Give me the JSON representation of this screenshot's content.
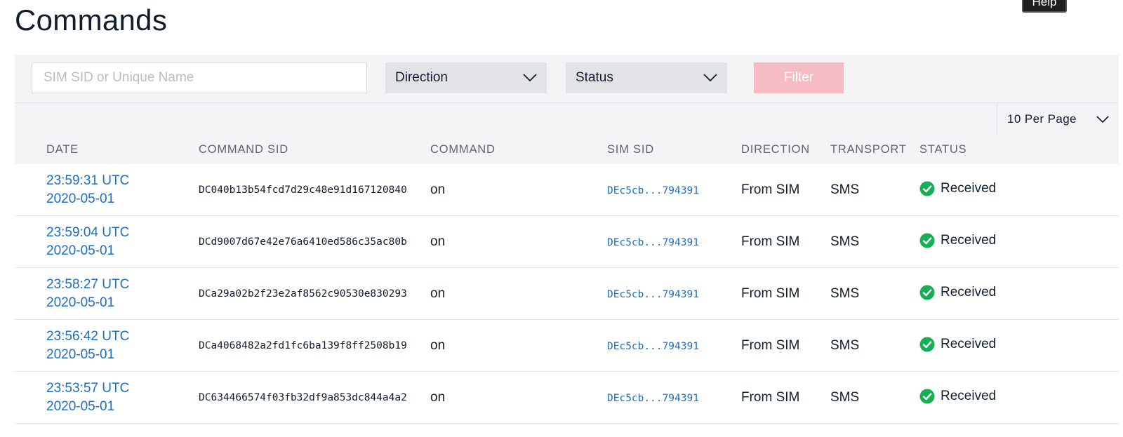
{
  "page": {
    "title": "Commands",
    "help_label": "Help"
  },
  "filters": {
    "search_placeholder": "SIM SID or Unique Name",
    "direction_label": "Direction",
    "status_label": "Status",
    "filter_button": "Filter",
    "per_page_label": "10 Per Page"
  },
  "table": {
    "headers": [
      "DATE",
      "COMMAND SID",
      "COMMAND",
      "SIM SID",
      "DIRECTION",
      "TRANSPORT",
      "STATUS"
    ],
    "rows": [
      {
        "time": "23:59:31 UTC",
        "date": "2020-05-01",
        "command_sid": "DC040b13b54fcd7d29c48e91d167120840",
        "command": "on",
        "sim_sid": "DEc5cb...794391",
        "direction": "From SIM",
        "transport": "SMS",
        "status": "Received"
      },
      {
        "time": "23:59:04 UTC",
        "date": "2020-05-01",
        "command_sid": "DCd9007d67e42e76a6410ed586c35ac80b",
        "command": "on",
        "sim_sid": "DEc5cb...794391",
        "direction": "From SIM",
        "transport": "SMS",
        "status": "Received"
      },
      {
        "time": "23:58:27 UTC",
        "date": "2020-05-01",
        "command_sid": "DCa29a02b2f23e2af8562c90530e830293",
        "command": "on",
        "sim_sid": "DEc5cb...794391",
        "direction": "From SIM",
        "transport": "SMS",
        "status": "Received"
      },
      {
        "time": "23:56:42 UTC",
        "date": "2020-05-01",
        "command_sid": "DCa4068482a2fd1fc6ba139f8ff2508b19",
        "command": "on",
        "sim_sid": "DEc5cb...794391",
        "direction": "From SIM",
        "transport": "SMS",
        "status": "Received"
      },
      {
        "time": "23:53:57 UTC",
        "date": "2020-05-01",
        "command_sid": "DC634466574f03fb32df9a853dc844a4a2",
        "command": "on",
        "sim_sid": "DEc5cb...794391",
        "direction": "From SIM",
        "transport": "SMS",
        "status": "Received"
      }
    ]
  },
  "colors": {
    "link": "#1f6ebf",
    "status_success": "#14b053",
    "filter_button_disabled": "#f6bcc3"
  },
  "icons": {
    "dropdown": "chevron-down-icon",
    "status": "check-circle-icon"
  }
}
